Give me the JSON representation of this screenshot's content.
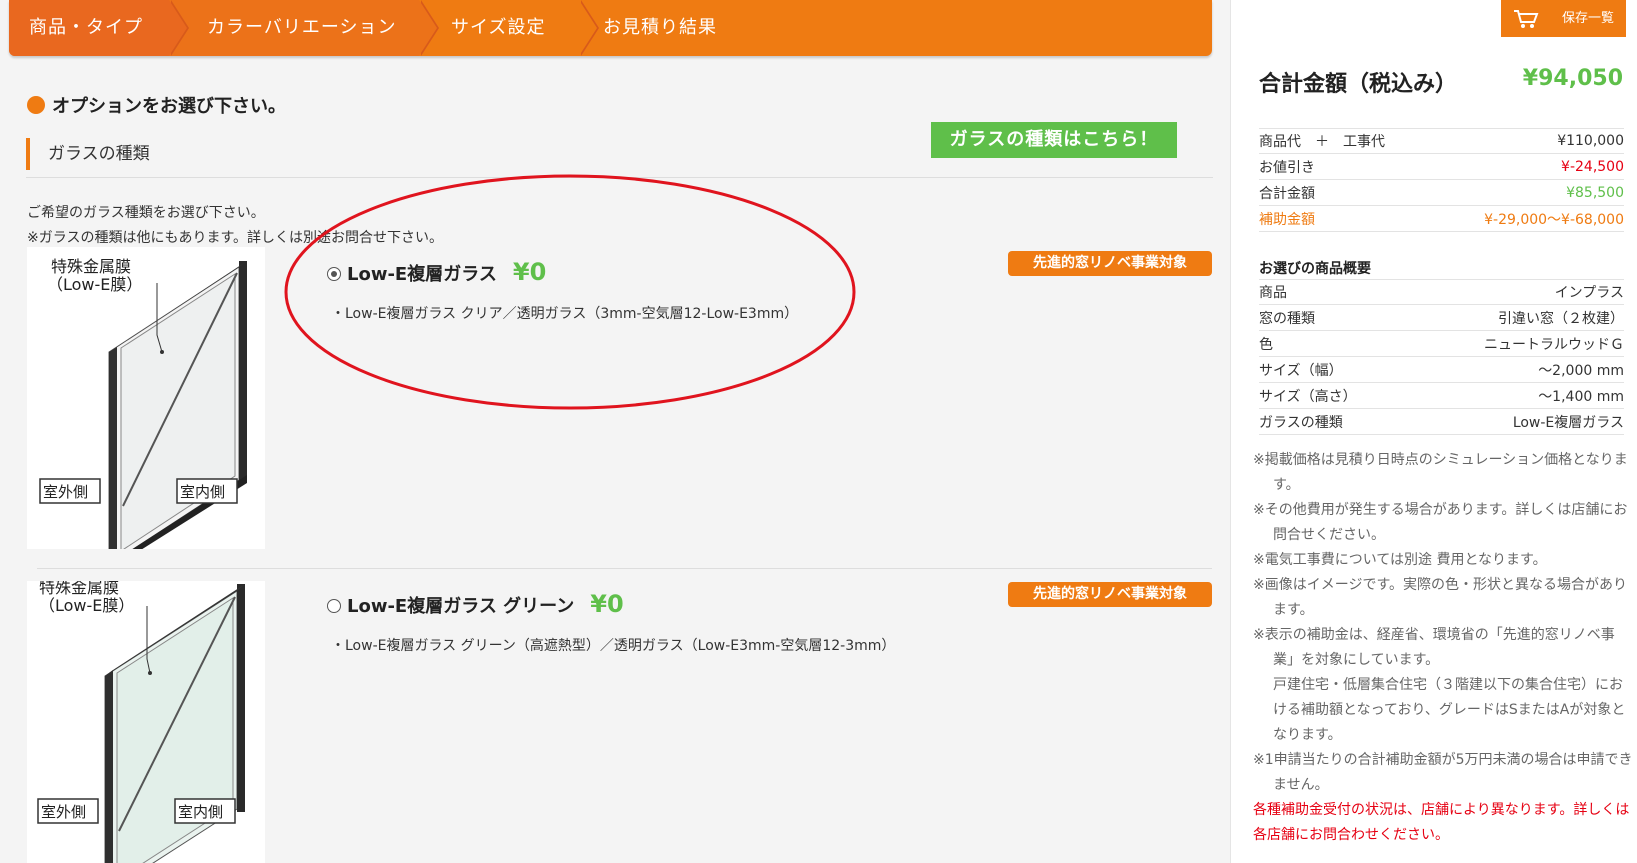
{
  "steps": [
    "商品・タイプ",
    "カラーバリエーション",
    "サイズ設定",
    "お見積り結果"
  ],
  "option_heading": "オプションをお選び下さい。",
  "section_title": "ガラスの種類",
  "glass_info_button": "ガラスの種類はこちら！",
  "intro_lines": [
    "ご希望のガラス種類をお選び下さい。",
    "※ガラスの種類は他にもあります。詳しくは別途お問合せ下さい。"
  ],
  "image_labels": {
    "metal_film_1": "特殊金属膜",
    "metal_film_2": "（Low-E膜）",
    "outdoor": "室外側",
    "indoor": "室内側"
  },
  "options": [
    {
      "name": "Low-E複層ガラス",
      "price": "¥0",
      "selected": true,
      "badge": "先進的窓リノベ事業対象",
      "description": "・Low-E複層ガラス クリア／透明ガラス（3mm-空気層12-Low-E3mm）"
    },
    {
      "name": "Low-E複層ガラス グリーン",
      "price": "¥0",
      "selected": false,
      "badge": "先進的窓リノベ事業対象",
      "description": "・Low-E複層ガラス グリーン（高遮熱型）／透明ガラス（Low-E3mm-空気層12-3mm）"
    }
  ],
  "sidebar": {
    "save_label": "保存一覧",
    "total_label": "合計金額（税込み）",
    "total_value": "¥94,050",
    "price_rows": [
      {
        "label": "商品代　＋　工事代",
        "value": "¥110,000"
      },
      {
        "label": "お値引き",
        "value": "¥-24,500"
      },
      {
        "label": "合計金額",
        "value": "¥85,500"
      },
      {
        "label": "補助金額",
        "value": "¥-29,000〜¥-68,000"
      }
    ],
    "summary_title": "お選びの商品概要",
    "summary_rows": [
      {
        "label": "商品",
        "value": "インプラス"
      },
      {
        "label": "窓の種類",
        "value": "引違い窓（２枚建）"
      },
      {
        "label": "色",
        "value": "ニュートラルウッドＧ"
      },
      {
        "label": "サイズ（幅）",
        "value": "〜2,000 mm"
      },
      {
        "label": "サイズ（高さ）",
        "value": "〜1,400 mm"
      },
      {
        "label": "ガラスの種類",
        "value": "Low-E複層ガラス"
      }
    ],
    "notes": [
      "※掲載価格は見積り日時点のシミュレーション価格となります。",
      "※その他費用が発生する場合があります。詳しくは店舗にお問合せください。",
      "※電気工事費については別途 費用となります。",
      "※画像はイメージです。実際の色・形状と異なる場合があります。",
      "※表示の補助金は、経産省、環境省の「先進的窓リノベ事業」を対象にしています。",
      "戸建住宅・低層集合住宅（３階建以下の集合住宅）における補助額となっており、グレードはSまたはAが対象となります。",
      "※1申請当たりの合計補助金額が5万円未満の場合は申請できません。"
    ],
    "warning": "各種補助金受付の状況は、店舗により異なります。詳しくは各店舗にお問合わせください。"
  },
  "colors": {
    "accent_orange": "#ef7b12",
    "price_green": "#5fbf4a",
    "discount_red": "#e60012",
    "annotation_red": "#e0141e"
  }
}
